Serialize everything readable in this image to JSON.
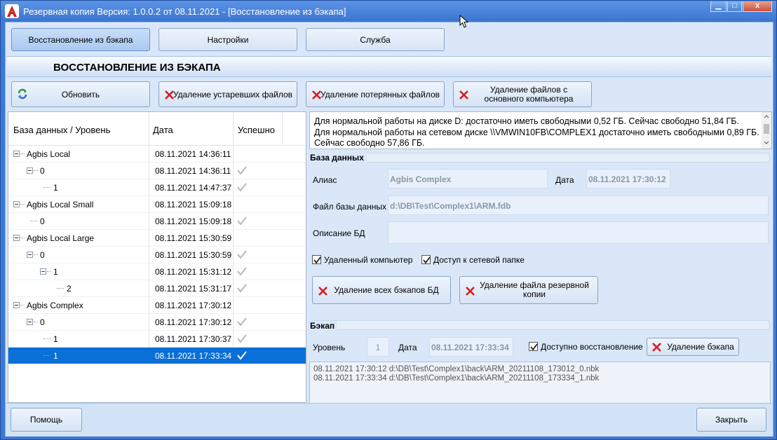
{
  "window": {
    "title": "Резервная копия   Версия: 1.0.0.2 от 08.11.2021 - [Восстановление из бэкапа]",
    "controls": {
      "minimize": "▁",
      "maximize": "□",
      "close": "x"
    }
  },
  "tabs": [
    {
      "label": "Восстановление из бэкапа",
      "active": true
    },
    {
      "label": "Настройки",
      "active": false
    },
    {
      "label": "Служба",
      "active": false
    }
  ],
  "section_title": "ВОССТАНОВЛЕНИЕ ИЗ БЭКАПА",
  "toolbar": {
    "refresh": "Обновить",
    "delete_old": "Удаление устаревших файлов",
    "delete_lost": "Удаление потерянных файлов",
    "delete_from_main": "Удаление файлов с основного компьютера"
  },
  "tree": {
    "headers": {
      "db": "База данных / Уровень",
      "date": "Дата",
      "success": "Успешно"
    },
    "rows": [
      {
        "name": "Agbis Local",
        "date": "08.11.2021 14:36:11",
        "ok": false
      },
      {
        "name": "0",
        "date": "08.11.2021 14:36:11",
        "ok": true
      },
      {
        "name": "1",
        "date": "08.11.2021 14:47:37",
        "ok": true
      },
      {
        "name": "Agbis Local Small",
        "date": "08.11.2021 15:09:18",
        "ok": false
      },
      {
        "name": "0",
        "date": "08.11.2021 15:09:18",
        "ok": true
      },
      {
        "name": "Agbis Local Large",
        "date": "08.11.2021 15:30:59",
        "ok": false
      },
      {
        "name": "0",
        "date": "08.11.2021 15:30:59",
        "ok": true
      },
      {
        "name": "1",
        "date": "08.11.2021 15:31:12",
        "ok": true
      },
      {
        "name": "2",
        "date": "08.11.2021 15:31:17",
        "ok": true
      },
      {
        "name": "Agbis Complex",
        "date": "08.11.2021 17:30:12",
        "ok": false
      },
      {
        "name": "0",
        "date": "08.11.2021 17:30:12",
        "ok": true
      },
      {
        "name": "1",
        "date": "08.11.2021 17:30:37",
        "ok": true
      },
      {
        "name": "1",
        "date": "08.11.2021 17:33:34",
        "ok": true
      }
    ]
  },
  "info": {
    "line1": "Для нормальной работы на диске D: достаточно иметь свободными 0,52 ГБ. Сейчас свободно 51,84 ГБ.",
    "line2": "Для нормальной работы на сетевом диске \\\\VMWIN10FB\\COMPLEX1 достаточно иметь свободными 0,89 ГБ.",
    "line3": "Сейчас свободно 57,86 ГБ."
  },
  "database": {
    "group_label": "База данных",
    "alias_label": "Алиас",
    "alias_value": "Agbis Complex",
    "date_label": "Дата",
    "date_value": "08.11.2021 17:30:12",
    "file_label": "Файл базы данных",
    "file_value": "d:\\DB\\Test\\Complex1\\ARM.fdb",
    "desc_label": "Описание БД",
    "desc_value": "",
    "remote_label": "Удаленный компьютер",
    "remote_checked": true,
    "network_label": "Доступ к сетевой папке",
    "network_checked": true,
    "delete_all_btn": "Удаление всех бэкапов БД",
    "delete_backup_file_btn": "Удаление файла резервной копии"
  },
  "backup": {
    "group_label": "Бэкап",
    "level_label": "Уровень",
    "level_value": "1",
    "date_label": "Дата",
    "date_value": "08.11.2021 17:33:34",
    "restore_label": "Доступно восстановление",
    "restore_checked": true,
    "delete_btn": "Удаление бэкапа",
    "files": [
      "08.11.2021 17:30:12 d:\\DB\\Test\\Complex1\\back\\ARM_20211108_173012_0.nbk",
      "08.11.2021 17:33:34 d:\\DB\\Test\\Complex1\\back\\ARM_20211108_173334_1.nbk"
    ]
  },
  "footer": {
    "help": "Помощь",
    "close": "Закрыть"
  },
  "colors": {
    "accent": "#0a6fd6",
    "delete_x": "#d81b1b",
    "window_bg": "#d9e7f8"
  }
}
